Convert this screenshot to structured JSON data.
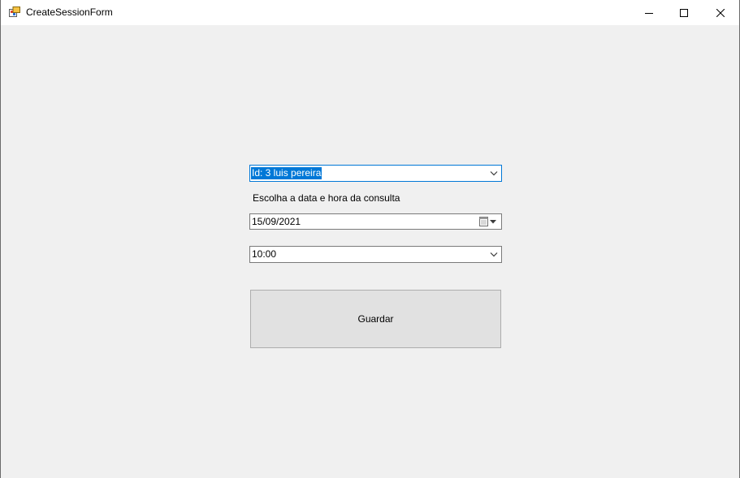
{
  "window": {
    "title": "CreateSessionForm",
    "icon": "winforms-app-icon",
    "controls": [
      "minimize-icon",
      "maximize-icon",
      "close-icon"
    ]
  },
  "form": {
    "patient_select": {
      "selected": "Id: 3 luis pereira",
      "icon": "chevron-down-icon"
    },
    "date_label": "Escolha a data e hora da consulta",
    "date_picker": {
      "value": "15/09/2021",
      "icon": "calendar-dropdown-icon"
    },
    "time_select": {
      "selected": "10:00",
      "icon": "chevron-down-icon"
    },
    "save_button_label": "Guardar"
  },
  "colors": {
    "client_bg": "#f0f0f0",
    "selection": "#0078d7",
    "button_bg": "#e1e1e1",
    "border": "#7a7a7a"
  }
}
